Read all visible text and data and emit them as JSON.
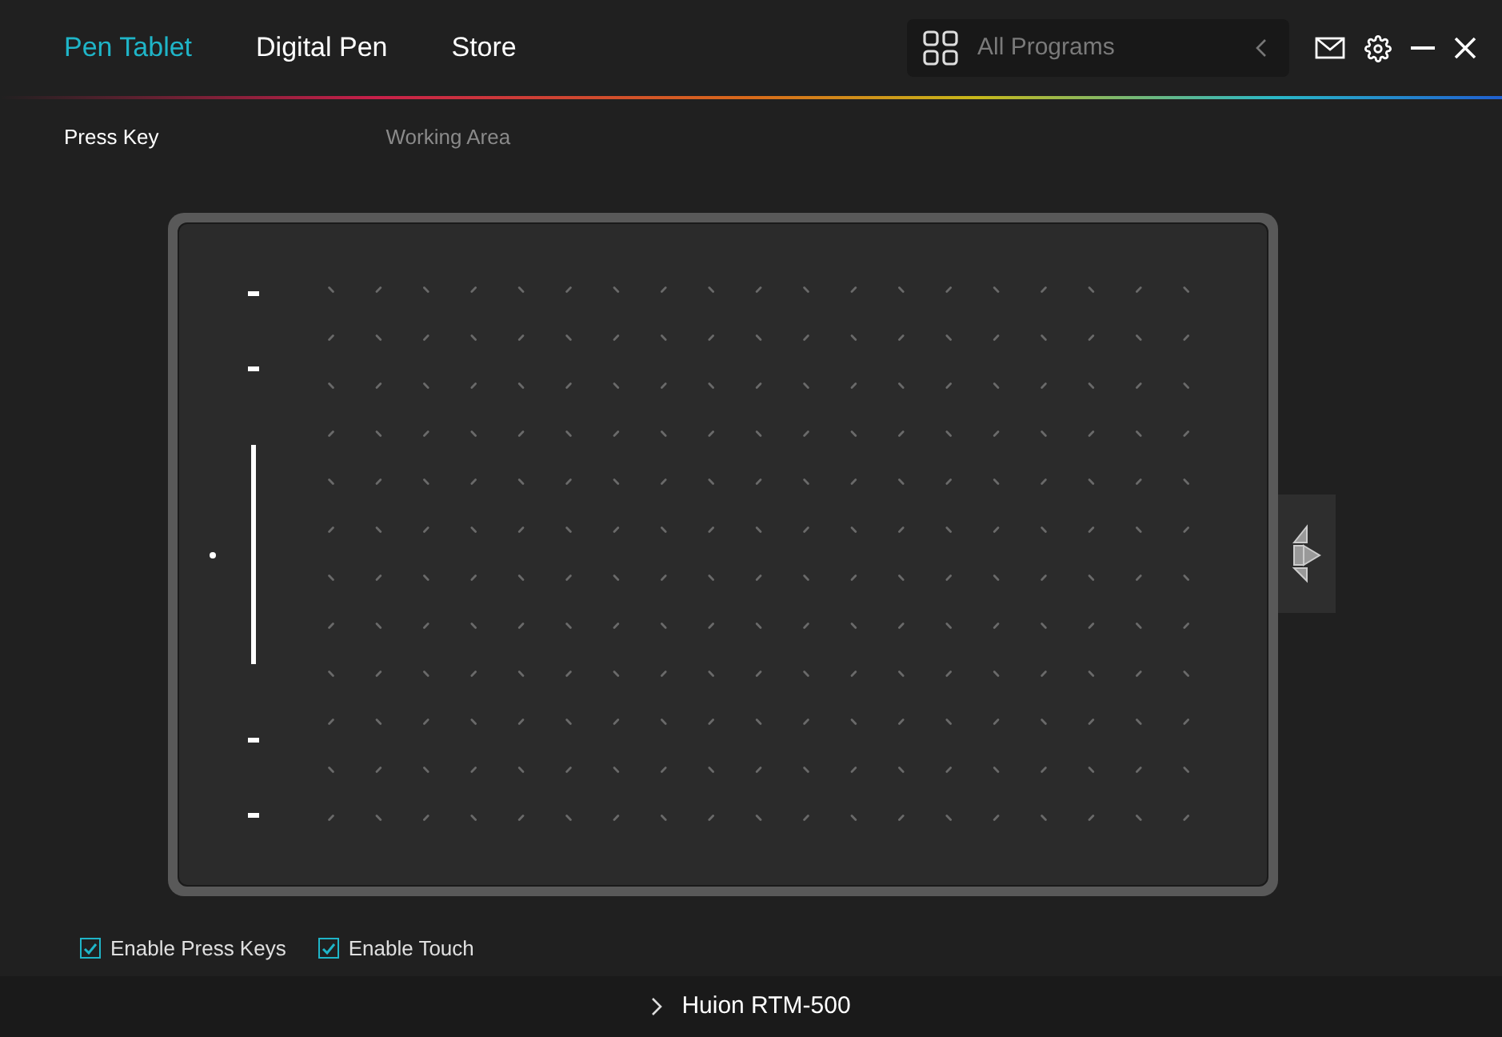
{
  "tabs": [
    {
      "label": "Pen Tablet",
      "selected": true
    },
    {
      "label": "Digital Pen",
      "selected": false
    },
    {
      "label": "Store",
      "selected": false
    }
  ],
  "program_selector": {
    "value": "All Programs"
  },
  "sub_tabs": [
    {
      "label": "Press Key",
      "selected": true
    },
    {
      "label": "Working Area",
      "selected": false
    }
  ],
  "options": [
    {
      "label": "Enable Press Keys",
      "checked": true
    },
    {
      "label": "Enable Touch",
      "checked": true
    }
  ],
  "device": {
    "name": "Huion RTM-500"
  }
}
